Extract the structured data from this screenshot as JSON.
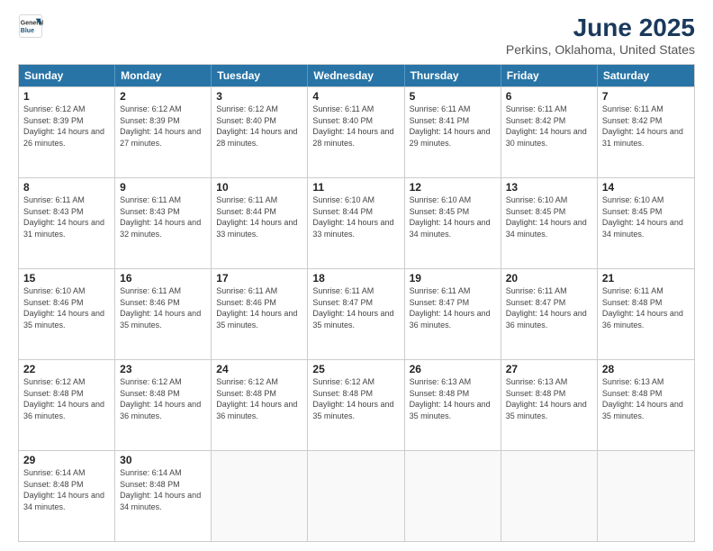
{
  "logo": {
    "general": "General",
    "blue": "Blue"
  },
  "title": "June 2025",
  "subtitle": "Perkins, Oklahoma, United States",
  "headers": [
    "Sunday",
    "Monday",
    "Tuesday",
    "Wednesday",
    "Thursday",
    "Friday",
    "Saturday"
  ],
  "weeks": [
    [
      {
        "day": "1",
        "sunrise": "Sunrise: 6:12 AM",
        "sunset": "Sunset: 8:39 PM",
        "daylight": "Daylight: 14 hours and 26 minutes."
      },
      {
        "day": "2",
        "sunrise": "Sunrise: 6:12 AM",
        "sunset": "Sunset: 8:39 PM",
        "daylight": "Daylight: 14 hours and 27 minutes."
      },
      {
        "day": "3",
        "sunrise": "Sunrise: 6:12 AM",
        "sunset": "Sunset: 8:40 PM",
        "daylight": "Daylight: 14 hours and 28 minutes."
      },
      {
        "day": "4",
        "sunrise": "Sunrise: 6:11 AM",
        "sunset": "Sunset: 8:40 PM",
        "daylight": "Daylight: 14 hours and 28 minutes."
      },
      {
        "day": "5",
        "sunrise": "Sunrise: 6:11 AM",
        "sunset": "Sunset: 8:41 PM",
        "daylight": "Daylight: 14 hours and 29 minutes."
      },
      {
        "day": "6",
        "sunrise": "Sunrise: 6:11 AM",
        "sunset": "Sunset: 8:42 PM",
        "daylight": "Daylight: 14 hours and 30 minutes."
      },
      {
        "day": "7",
        "sunrise": "Sunrise: 6:11 AM",
        "sunset": "Sunset: 8:42 PM",
        "daylight": "Daylight: 14 hours and 31 minutes."
      }
    ],
    [
      {
        "day": "8",
        "sunrise": "Sunrise: 6:11 AM",
        "sunset": "Sunset: 8:43 PM",
        "daylight": "Daylight: 14 hours and 31 minutes."
      },
      {
        "day": "9",
        "sunrise": "Sunrise: 6:11 AM",
        "sunset": "Sunset: 8:43 PM",
        "daylight": "Daylight: 14 hours and 32 minutes."
      },
      {
        "day": "10",
        "sunrise": "Sunrise: 6:11 AM",
        "sunset": "Sunset: 8:44 PM",
        "daylight": "Daylight: 14 hours and 33 minutes."
      },
      {
        "day": "11",
        "sunrise": "Sunrise: 6:10 AM",
        "sunset": "Sunset: 8:44 PM",
        "daylight": "Daylight: 14 hours and 33 minutes."
      },
      {
        "day": "12",
        "sunrise": "Sunrise: 6:10 AM",
        "sunset": "Sunset: 8:45 PM",
        "daylight": "Daylight: 14 hours and 34 minutes."
      },
      {
        "day": "13",
        "sunrise": "Sunrise: 6:10 AM",
        "sunset": "Sunset: 8:45 PM",
        "daylight": "Daylight: 14 hours and 34 minutes."
      },
      {
        "day": "14",
        "sunrise": "Sunrise: 6:10 AM",
        "sunset": "Sunset: 8:45 PM",
        "daylight": "Daylight: 14 hours and 34 minutes."
      }
    ],
    [
      {
        "day": "15",
        "sunrise": "Sunrise: 6:10 AM",
        "sunset": "Sunset: 8:46 PM",
        "daylight": "Daylight: 14 hours and 35 minutes."
      },
      {
        "day": "16",
        "sunrise": "Sunrise: 6:11 AM",
        "sunset": "Sunset: 8:46 PM",
        "daylight": "Daylight: 14 hours and 35 minutes."
      },
      {
        "day": "17",
        "sunrise": "Sunrise: 6:11 AM",
        "sunset": "Sunset: 8:46 PM",
        "daylight": "Daylight: 14 hours and 35 minutes."
      },
      {
        "day": "18",
        "sunrise": "Sunrise: 6:11 AM",
        "sunset": "Sunset: 8:47 PM",
        "daylight": "Daylight: 14 hours and 35 minutes."
      },
      {
        "day": "19",
        "sunrise": "Sunrise: 6:11 AM",
        "sunset": "Sunset: 8:47 PM",
        "daylight": "Daylight: 14 hours and 36 minutes."
      },
      {
        "day": "20",
        "sunrise": "Sunrise: 6:11 AM",
        "sunset": "Sunset: 8:47 PM",
        "daylight": "Daylight: 14 hours and 36 minutes."
      },
      {
        "day": "21",
        "sunrise": "Sunrise: 6:11 AM",
        "sunset": "Sunset: 8:48 PM",
        "daylight": "Daylight: 14 hours and 36 minutes."
      }
    ],
    [
      {
        "day": "22",
        "sunrise": "Sunrise: 6:12 AM",
        "sunset": "Sunset: 8:48 PM",
        "daylight": "Daylight: 14 hours and 36 minutes."
      },
      {
        "day": "23",
        "sunrise": "Sunrise: 6:12 AM",
        "sunset": "Sunset: 8:48 PM",
        "daylight": "Daylight: 14 hours and 36 minutes."
      },
      {
        "day": "24",
        "sunrise": "Sunrise: 6:12 AM",
        "sunset": "Sunset: 8:48 PM",
        "daylight": "Daylight: 14 hours and 36 minutes."
      },
      {
        "day": "25",
        "sunrise": "Sunrise: 6:12 AM",
        "sunset": "Sunset: 8:48 PM",
        "daylight": "Daylight: 14 hours and 35 minutes."
      },
      {
        "day": "26",
        "sunrise": "Sunrise: 6:13 AM",
        "sunset": "Sunset: 8:48 PM",
        "daylight": "Daylight: 14 hours and 35 minutes."
      },
      {
        "day": "27",
        "sunrise": "Sunrise: 6:13 AM",
        "sunset": "Sunset: 8:48 PM",
        "daylight": "Daylight: 14 hours and 35 minutes."
      },
      {
        "day": "28",
        "sunrise": "Sunrise: 6:13 AM",
        "sunset": "Sunset: 8:48 PM",
        "daylight": "Daylight: 14 hours and 35 minutes."
      }
    ],
    [
      {
        "day": "29",
        "sunrise": "Sunrise: 6:14 AM",
        "sunset": "Sunset: 8:48 PM",
        "daylight": "Daylight: 14 hours and 34 minutes."
      },
      {
        "day": "30",
        "sunrise": "Sunrise: 6:14 AM",
        "sunset": "Sunset: 8:48 PM",
        "daylight": "Daylight: 14 hours and 34 minutes."
      },
      {
        "day": "",
        "sunrise": "",
        "sunset": "",
        "daylight": ""
      },
      {
        "day": "",
        "sunrise": "",
        "sunset": "",
        "daylight": ""
      },
      {
        "day": "",
        "sunrise": "",
        "sunset": "",
        "daylight": ""
      },
      {
        "day": "",
        "sunrise": "",
        "sunset": "",
        "daylight": ""
      },
      {
        "day": "",
        "sunrise": "",
        "sunset": "",
        "daylight": ""
      }
    ]
  ]
}
